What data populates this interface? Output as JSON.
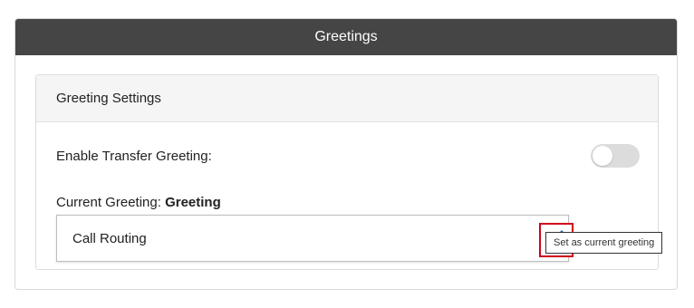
{
  "panel": {
    "title": "Greetings"
  },
  "settings": {
    "title": "Greeting Settings",
    "enable_transfer_label": "Enable Transfer Greeting:",
    "enable_transfer_on": false,
    "current_greeting_label": "Current Greeting:",
    "current_greeting_value": "Greeting",
    "greeting_select_value": "Call Routing",
    "edit_tooltip": "Set as current greeting"
  },
  "icons": {
    "edit": "edit-icon",
    "chevron": "chevron-down-icon"
  },
  "colors": {
    "header_bg": "#454545",
    "edit_icon": "#2e6db4",
    "highlight_border": "#d0021b",
    "toggle_off": "#dcdcdc"
  }
}
